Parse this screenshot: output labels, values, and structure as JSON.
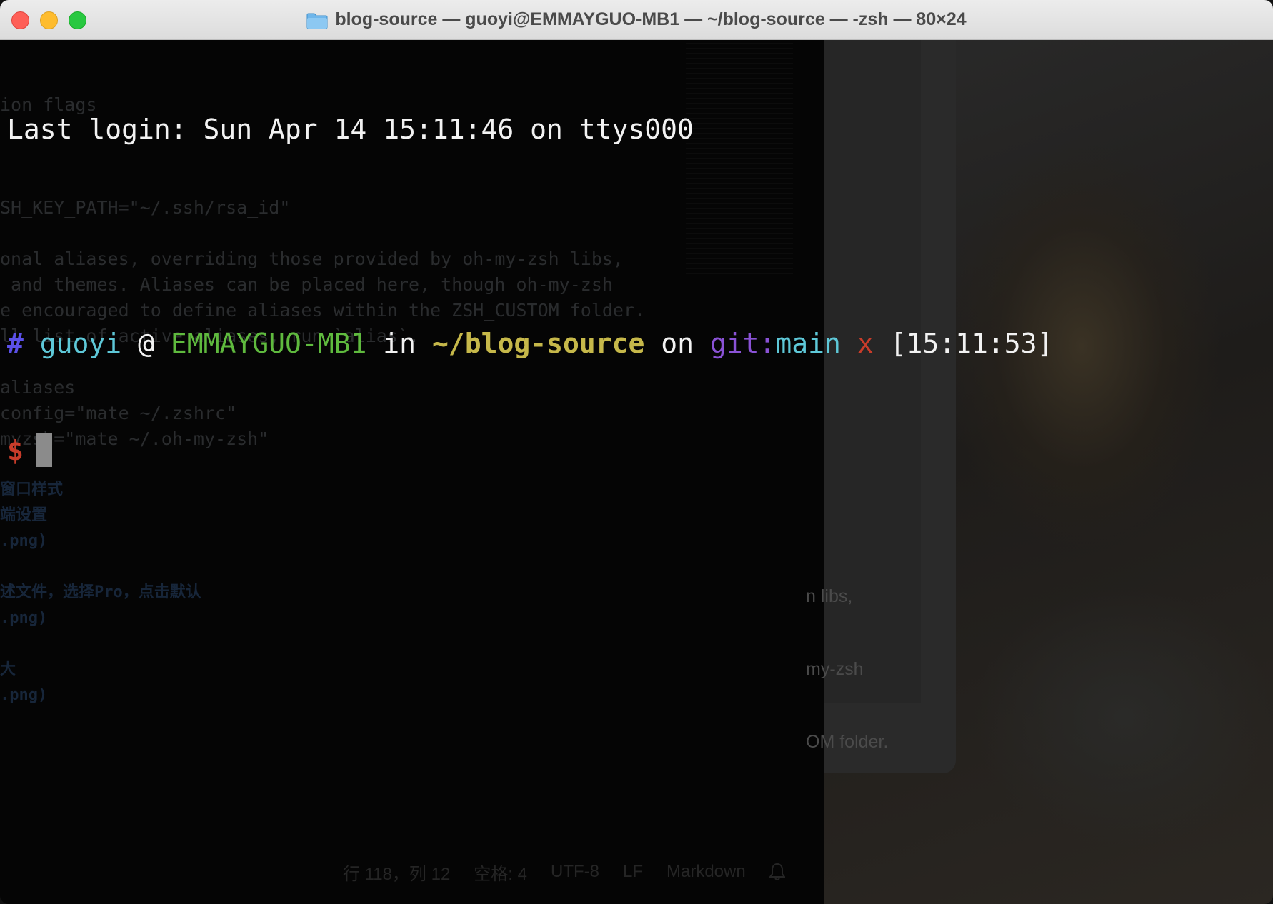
{
  "window": {
    "title": "blog-source — guoyi@EMMAYGUO-MB1 — ~/blog-source — -zsh — 80×24"
  },
  "terminal": {
    "last_login": "Last login: Sun Apr 14 15:11:46 on ttys000",
    "prompt": {
      "hash": "#",
      "user": "guoyi",
      "at": "@",
      "host": "EMMAYGUO-MB1",
      "in": "in",
      "path": "~/blog-source",
      "on": "on",
      "git_label": "git:",
      "branch": "main",
      "dirty": "x",
      "time": "[15:11:53]",
      "dollar": "$"
    }
  },
  "background_editor": {
    "lines": [
      "ion flags",
      "",
      "",
      "",
      "SH_KEY_PATH=\"~/.ssh/rsa_id\"",
      "",
      "onal aliases, overriding those provided by oh-my-zsh libs,",
      " and themes. Aliases can be placed here, though oh-my-zsh",
      "e encouraged to define aliases within the ZSH_CUSTOM folder.",
      "ll list of active aliases, run `alias`.",
      "",
      "aliases",
      "config=\"mate ~/.zshrc\"",
      "myzsh=\"mate ~/.oh-my-zsh\""
    ],
    "cn_lines": [
      "窗口样式",
      "端设置",
      ".png)",
      "",
      "述文件，选择Pro，点击默认",
      ".png)",
      "",
      "大",
      ".png)"
    ],
    "right_lines": [
      "n libs,",
      "my-zsh",
      "OM folder."
    ],
    "status": {
      "position": "行 118，列 12",
      "spaces": "空格: 4",
      "encoding": "UTF-8",
      "line_ending": "LF",
      "language": "Markdown"
    }
  }
}
